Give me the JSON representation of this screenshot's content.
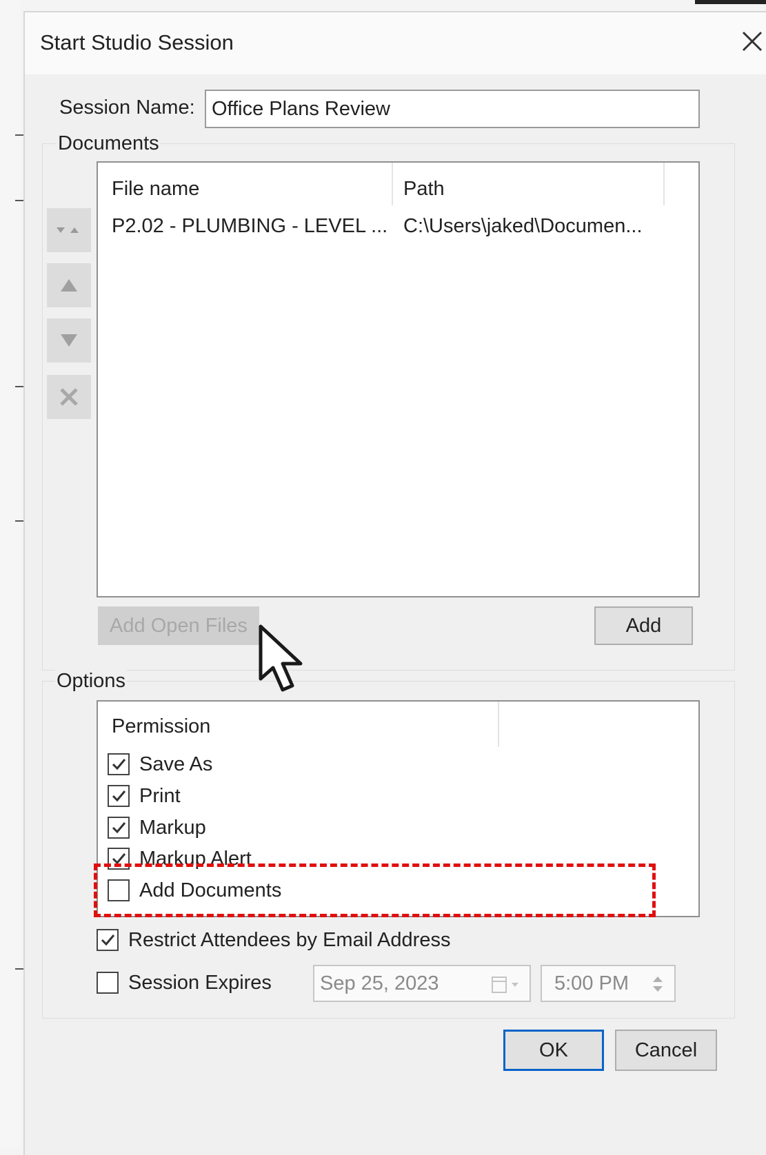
{
  "dialog": {
    "title": "Start Studio Session",
    "session_name_label": "Session Name:",
    "session_name_value": "Office Plans Review"
  },
  "documents": {
    "group_label": "Documents",
    "columns": [
      "File name",
      "Path"
    ],
    "rows": [
      {
        "file_name": "P2.02 - PLUMBING - LEVEL ...",
        "path": "C:\\Users\\jaked\\Documen..."
      }
    ],
    "side_buttons": [
      "sort-icon",
      "move-up-icon",
      "move-down-icon",
      "remove-icon"
    ],
    "add_open_files_label": "Add Open Files",
    "add_label": "Add"
  },
  "options": {
    "group_label": "Options",
    "permission_header": "Permission",
    "permissions": [
      {
        "label": "Save As",
        "checked": true
      },
      {
        "label": "Print",
        "checked": true
      },
      {
        "label": "Markup",
        "checked": true
      },
      {
        "label": "Markup Alert",
        "checked": true
      },
      {
        "label": "Add Documents",
        "checked": false
      }
    ],
    "restrict_label": "Restrict Attendees by Email Address",
    "restrict_checked": true,
    "expires_label": "Session Expires",
    "expires_checked": false,
    "expire_date": "Sep 25, 2023",
    "expire_time": "5:00 PM"
  },
  "footer": {
    "ok_label": "OK",
    "cancel_label": "Cancel"
  },
  "colors": {
    "highlight": "#e01010",
    "default_button_border": "#0a63c8"
  }
}
